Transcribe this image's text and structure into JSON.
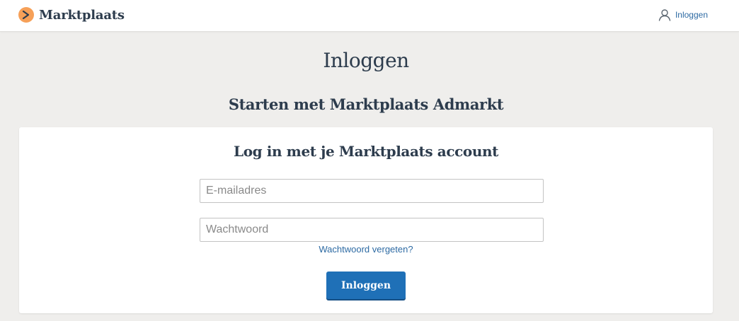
{
  "header": {
    "logo_text": "Marktplaats",
    "login_label": "Inloggen"
  },
  "page": {
    "title": "Inloggen",
    "subtitle": "Starten met Marktplaats Admarkt"
  },
  "login_card": {
    "title": "Log in met je Marktplaats account",
    "email_placeholder": "E-mailadres",
    "email_value": "",
    "password_placeholder": "Wachtwoord",
    "password_value": "",
    "forgot_label": "Wachtwoord vergeten?",
    "submit_label": "Inloggen"
  },
  "colors": {
    "brand_orange": "#f6a058",
    "text_dark": "#2d3c4d",
    "link_blue": "#2d6aa3",
    "button_blue": "#1f70b7",
    "page_background": "#efeeec"
  },
  "icons": {
    "logo": "marktplaats-logo-icon",
    "user": "user-icon"
  }
}
